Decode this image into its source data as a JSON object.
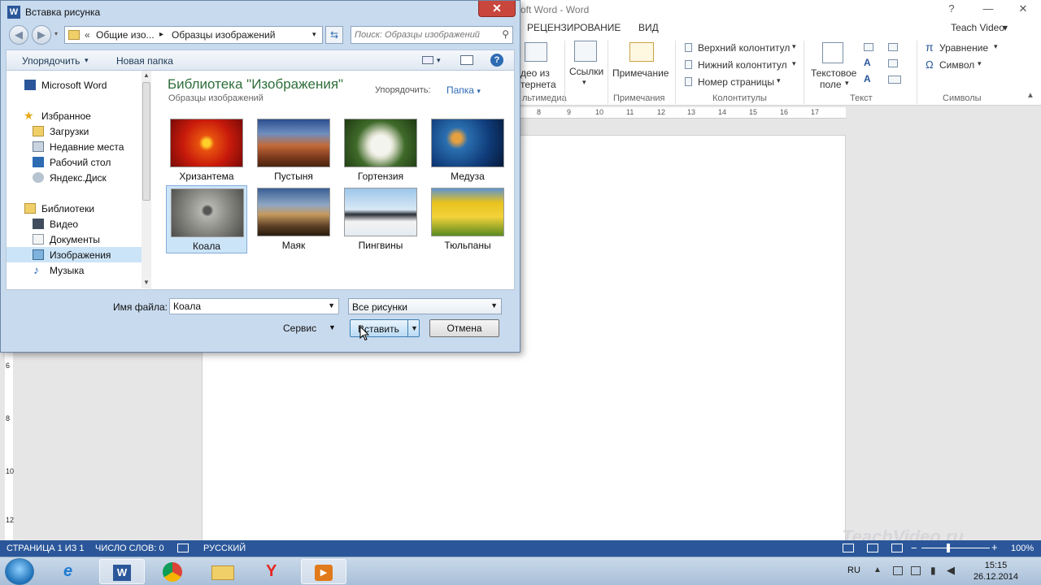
{
  "word": {
    "title": "oft Word - Word",
    "tabs": [
      "РЕЦЕНЗИРОВАНИЕ",
      "ВИД"
    ],
    "user": "Teach Video",
    "ribbon": {
      "video_label_1": "део из",
      "video_label_2": "тернета",
      "media_group": "льтимедиа",
      "links": "Ссылки",
      "comment": "Примечание",
      "comments_group": "Примечания",
      "header": "Верхний колонтитул",
      "footer": "Нижний колонтитул",
      "page_number": "Номер страницы",
      "hf_group": "Колонтитулы",
      "textbox_1": "Текстовое",
      "textbox_2": "поле",
      "text_group": "Текст",
      "equation": "Уравнение",
      "symbol": "Символ",
      "symbols_group": "Символы"
    },
    "ruler_numbers": [
      "8",
      "9",
      "10",
      "11",
      "12",
      "13",
      "14",
      "15",
      "16",
      "17"
    ],
    "ruler_v_numbers": [
      "6",
      "8",
      "10",
      "12"
    ],
    "status": {
      "page": "СТРАНИЦА 1 ИЗ 1",
      "words": "ЧИСЛО СЛОВ: 0",
      "language": "РУССКИЙ",
      "zoom": "100%"
    },
    "watermark": "TeachVideo.ru"
  },
  "taskbar": {
    "lang": "RU",
    "time": "15:15",
    "date": "26.12.2014"
  },
  "dialog": {
    "title": "Вставка рисунка",
    "breadcrumb": [
      "Общие изо...",
      "Образцы изображений"
    ],
    "search_placeholder": "Поиск: Образцы изображений",
    "toolbar": {
      "arrange": "Упорядочить",
      "new_folder": "Новая папка"
    },
    "nav": [
      {
        "label": "Microsoft Word",
        "icon": "word-icon"
      },
      {
        "label": "Избранное",
        "icon": "star-icon"
      },
      {
        "label": "Загрузки",
        "icon": "downloads-folder-icon"
      },
      {
        "label": "Недавние места",
        "icon": "recent-places-icon"
      },
      {
        "label": "Рабочий стол",
        "icon": "desktop-icon"
      },
      {
        "label": "Яндекс.Диск",
        "icon": "yandex-disk-icon"
      },
      {
        "label": "Библиотеки",
        "icon": "libraries-icon"
      },
      {
        "label": "Видео",
        "icon": "video-library-icon"
      },
      {
        "label": "Документы",
        "icon": "documents-library-icon"
      },
      {
        "label": "Изображения",
        "icon": "pictures-library-icon"
      },
      {
        "label": "Музыка",
        "icon": "music-library-icon"
      }
    ],
    "library_title": "Библиотека \"Изображения\"",
    "library_sub": "Образцы изображений",
    "arrange_by_label": "Упорядочить:",
    "arrange_by_value": "Папка",
    "images": [
      {
        "label": "Хризантема"
      },
      {
        "label": "Пустыня"
      },
      {
        "label": "Гортензия"
      },
      {
        "label": "Медуза"
      },
      {
        "label": "Коала"
      },
      {
        "label": "Маяк"
      },
      {
        "label": "Пингвины"
      },
      {
        "label": "Тюльпаны"
      }
    ],
    "filename_label": "Имя файла:",
    "filename_value": "Коала",
    "filter": "Все рисунки",
    "service": "Сервис",
    "insert": "Вставить",
    "cancel": "Отмена"
  }
}
